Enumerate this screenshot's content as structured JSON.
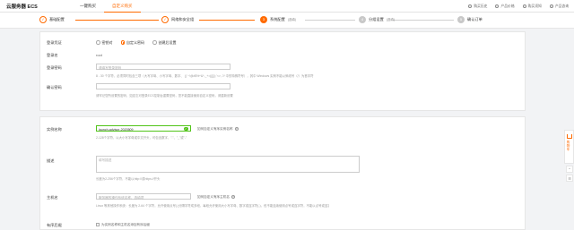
{
  "topbar": {
    "brand": "云服务器 ECS",
    "tabs": [
      {
        "label": "一键购买",
        "active": false
      },
      {
        "label": "自定义购买",
        "active": true
      }
    ],
    "links": [
      {
        "label": "购买历史",
        "icon": "history-icon"
      },
      {
        "label": "产品价格",
        "icon": "price-icon"
      },
      {
        "label": "购买须知",
        "icon": "notice-icon"
      },
      {
        "label": "产品咨询",
        "icon": "consult-icon"
      }
    ]
  },
  "steps": [
    {
      "num": "✓",
      "label": "基础配置",
      "sub": "",
      "state": "done"
    },
    {
      "num": "✓",
      "label": "网络和安全组",
      "sub": "",
      "state": "done"
    },
    {
      "num": "3",
      "label": "系统配置",
      "sub": "(选填)",
      "state": "current"
    },
    {
      "num": "4",
      "label": "分组设置",
      "sub": "(选填)",
      "state": "todo"
    },
    {
      "num": "5",
      "label": "确认订单",
      "sub": "",
      "state": "todo"
    }
  ],
  "login": {
    "label": "登录凭证",
    "options": [
      {
        "label": "密钥对",
        "selected": false
      },
      {
        "label": "自定义密码",
        "selected": true
      },
      {
        "label": "创建后设置",
        "selected": false
      }
    ]
  },
  "login_name": {
    "label": "登录名",
    "value": "root"
  },
  "login_password": {
    "label": "登录密码",
    "placeholder": "请填写登录密码",
    "hint": "8 - 30 个字符，必须同时包含三项（大写字母、小写字母、数字、 ()`~!@#$%^&*-_+=|{}[]:;'<>,.?/ 中的特殊符号），其中 Windows 实例不能以斜线号（/）为首字符"
  },
  "confirm_password": {
    "label": "确认密码",
    "hint": "请牢记您所设置的密码，如遗忘可登录ECS控制台重置密码，您不能直接使用自定义密码，请重新设置"
  },
  "instance_name": {
    "label": "实例名称",
    "value": "launch-advisor-2020509",
    "hint": "2-128个字符，以大小写字母或中文开头，可包含数字、\".\"、\"_\"或\"-\"",
    "help": "如何自定义有序实例名称"
  },
  "description": {
    "label": "描述",
    "placeholder": "填写描述",
    "hint": "长度为2-256个字符，不能以http://或https://开头"
  },
  "hostname": {
    "label": "主机名",
    "placeholder": "服务器的操作系统名称，选填项",
    "help": "如何自定义有序主机名",
    "hint": "Linux 等其他操作系统：长度为 2-64 个字符，允许使用点号(.)分隔字符成多段，每段允许使用大小写字母、数字或连字符(-)，但不能连续使用点号或连字符，不能以点号或连字符开头或结尾"
  },
  "ordered": {
    "label": "有序后缀",
    "option": "为实例名称和主机名添加有序后缀"
  },
  "side": {
    "cart_text": "购物车",
    "mini_top": "⌃",
    "mini_bottom": "☰"
  },
  "colors": {
    "accent": "#ff6a00",
    "success": "#52c41a"
  }
}
